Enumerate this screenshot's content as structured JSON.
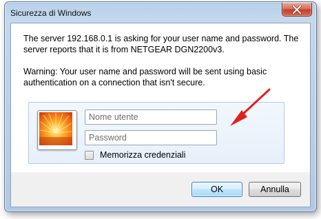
{
  "window": {
    "title": "Sicurezza di Windows",
    "close_icon": "close-icon"
  },
  "message": {
    "line1": "The server 192.168.0.1 is asking for your user name and password. The server reports that it is from NETGEAR DGN2200v3.",
    "line2": "Warning: Your user name and password will be sent using basic authentication on a connection that isn't secure."
  },
  "credentials": {
    "user_tile_icon": "flower-user-tile-icon",
    "username_placeholder": "Nome utente",
    "username_value": "",
    "password_placeholder": "Password",
    "password_value": "",
    "remember_label": "Memorizza credenziali",
    "remember_checked": false
  },
  "annotation": {
    "arrow_icon": "red-arrow-icon",
    "color": "#e0201b"
  },
  "buttons": {
    "ok_label": "OK",
    "cancel_label": "Annulla"
  }
}
